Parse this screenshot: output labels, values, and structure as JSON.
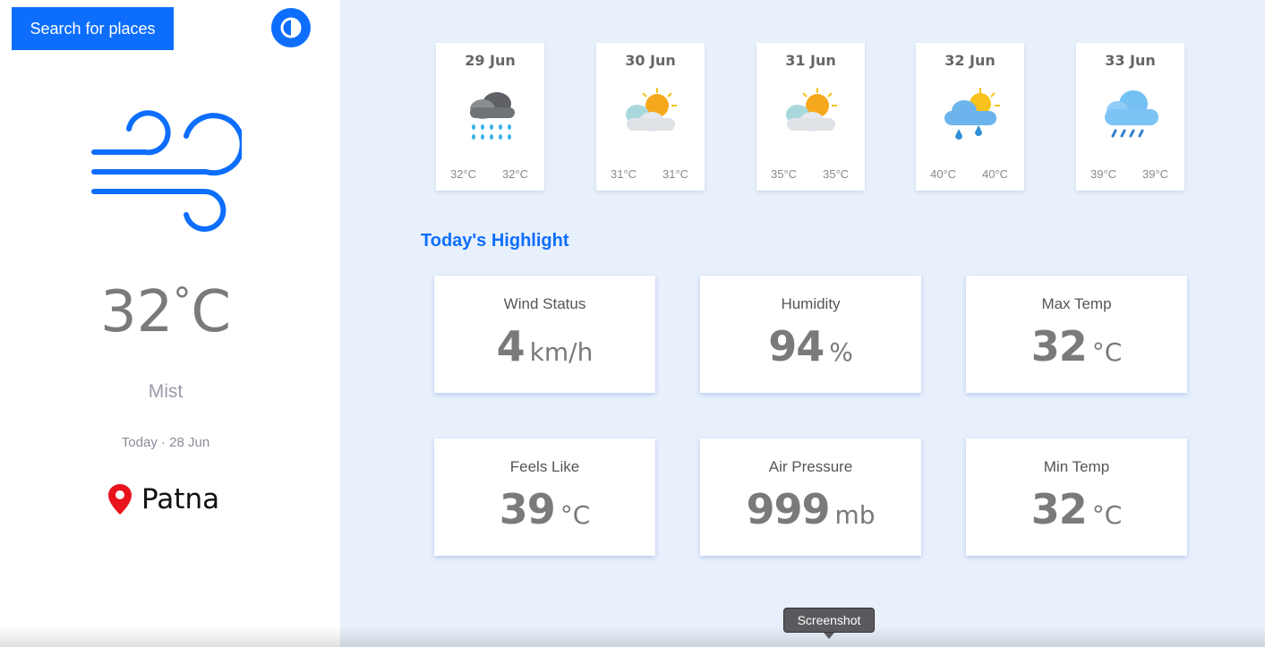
{
  "sidebar": {
    "search_label": "Search for places",
    "current": {
      "temp": "32",
      "unit": "°C",
      "condition": "Mist",
      "date": "Today · 28 Jun",
      "city": "Patna",
      "icon": "wind-icon"
    }
  },
  "forecast": [
    {
      "date": "29 Jun",
      "min": "32°C",
      "max": "32°C",
      "icon": "heavy-rain-cloud-icon"
    },
    {
      "date": "30 Jun",
      "min": "31°C",
      "max": "31°C",
      "icon": "sun-behind-clouds-icon"
    },
    {
      "date": "31 Jun",
      "min": "35°C",
      "max": "35°C",
      "icon": "sun-behind-clouds-icon"
    },
    {
      "date": "32 Jun",
      "min": "40°C",
      "max": "40°C",
      "icon": "sun-rain-cloud-icon"
    },
    {
      "date": "33 Jun",
      "min": "39°C",
      "max": "39°C",
      "icon": "rain-cloud-icon"
    }
  ],
  "highlights": {
    "title": "Today's Highlight",
    "cards": [
      {
        "label": "Wind Status",
        "value": "4",
        "unit": "km/h"
      },
      {
        "label": "Humidity",
        "value": "94",
        "unit": "%"
      },
      {
        "label": "Max Temp",
        "value": "32",
        "unit": "°C"
      },
      {
        "label": "Feels Like",
        "value": "39",
        "unit": "°C"
      },
      {
        "label": "Air Pressure",
        "value": "999",
        "unit": "mb"
      },
      {
        "label": "Min Temp",
        "value": "32",
        "unit": "°C"
      }
    ]
  },
  "tooltip": {
    "text": "Screenshot"
  },
  "colors": {
    "accent": "#0d6efd",
    "background": "#e8f0fb",
    "pin": "#e8131b"
  }
}
